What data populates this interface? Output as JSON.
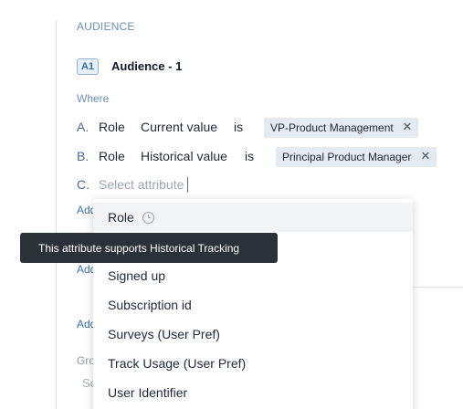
{
  "section": {
    "title": "AUDIENCE"
  },
  "audience": {
    "badge": "A1",
    "name": "Audience - 1"
  },
  "where_label": "Where",
  "conditions": [
    {
      "letter": "A.",
      "attribute": "Role",
      "mode": "Current value",
      "operator": "is",
      "value": "VP-Product Management"
    },
    {
      "letter": "B.",
      "attribute": "Role",
      "mode": "Historical value",
      "operator": "is",
      "value": "Principal Product Manager"
    },
    {
      "letter": "C.",
      "placeholder": "Select attribute"
    }
  ],
  "partial_labels": {
    "add": "Add",
    "group": "Gro",
    "select": "Se"
  },
  "dropdown": {
    "items": [
      {
        "label": "Role",
        "icon": "clock-icon",
        "highlighted": true
      },
      {
        "label": "Signed up"
      },
      {
        "label": "Subscription id"
      },
      {
        "label": "Surveys (User Pref)"
      },
      {
        "label": "Track Usage (User Pref)"
      },
      {
        "label": "User Identifier"
      }
    ]
  },
  "tooltip": {
    "text": "This attribute supports Historical Tracking"
  },
  "icons": {
    "remove": "close-icon",
    "history": "clock-icon"
  }
}
